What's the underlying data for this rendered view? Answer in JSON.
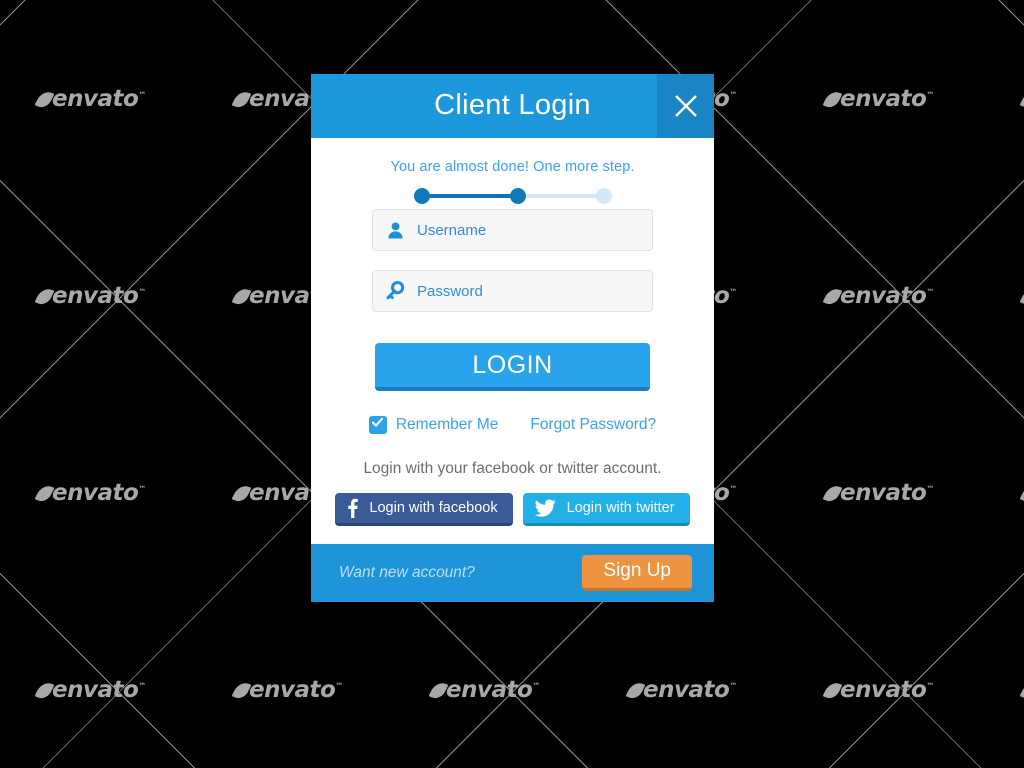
{
  "background": {
    "color": "#000000",
    "watermark_text": "envato",
    "watermark_tm": "™"
  },
  "modal": {
    "header": {
      "title": "Client Login",
      "close_icon": "close-icon",
      "background_color": "#1d97dc",
      "close_background_color": "#1a85c4"
    },
    "progress": {
      "message": "You are almost done! One more step.",
      "steps_total": 3,
      "steps_completed": 2,
      "active_color": "#1279bd",
      "inactive_color": "#d3e9f7"
    },
    "fields": [
      {
        "name": "username",
        "icon": "user-icon",
        "placeholder": "Username",
        "value": ""
      },
      {
        "name": "password",
        "icon": "key-icon",
        "placeholder": "Password",
        "value": ""
      }
    ],
    "login_button": {
      "label": "LOGIN",
      "color": "#29a3ec"
    },
    "remember": {
      "label": "Remember Me",
      "checked": true,
      "checkbox_color": "#29a3ec"
    },
    "forgot_password": {
      "label": "Forgot Password?"
    },
    "social": {
      "note": "Login with your facebook or twitter account.",
      "buttons": [
        {
          "label": "Login with facebook",
          "icon": "facebook-icon",
          "color": "#3a5a98"
        },
        {
          "label": "Login with twitter",
          "icon": "twitter-icon",
          "color": "#22b0e8"
        }
      ]
    },
    "footer": {
      "text": "Want new account?",
      "signup_label": "Sign Up",
      "background_color": "#1d93d8",
      "signup_color": "#ee9440"
    }
  }
}
